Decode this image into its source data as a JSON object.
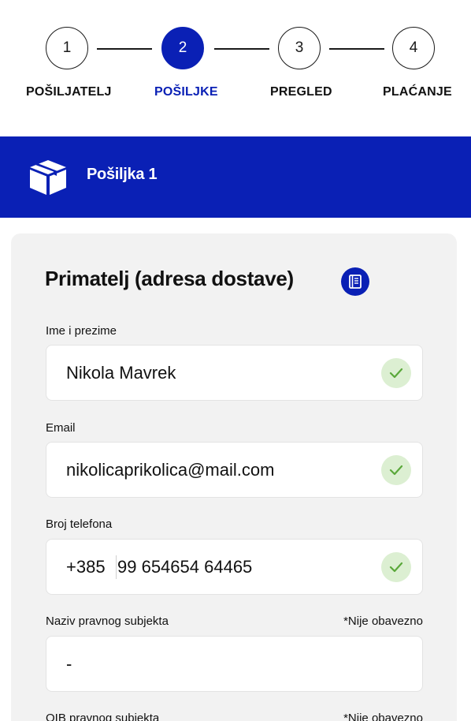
{
  "stepper": {
    "steps": [
      {
        "number": "1",
        "label": "POŠILJATELJ",
        "active": false
      },
      {
        "number": "2",
        "label": "POŠILJKE",
        "active": true
      },
      {
        "number": "3",
        "label": "PREGLED",
        "active": false
      },
      {
        "number": "4",
        "label": "PLAĆANJE",
        "active": false
      }
    ]
  },
  "banner": {
    "title": "Pošiljka 1",
    "icon": "package-box-icon"
  },
  "form": {
    "title": "Primatelj (adresa dostave)",
    "address_book_icon": "address-book-icon",
    "fields": [
      {
        "label": "Ime i prezime",
        "value": "Nikola Mavrek",
        "valid": true
      },
      {
        "label": "Email",
        "value": "nikolicaprikolica@mail.com",
        "valid": true
      },
      {
        "label": "Broj telefona",
        "prefix": "+385",
        "value": "99 654654 64465",
        "valid": true
      },
      {
        "label": "Naziv pravnog subjekta",
        "optional": "*Nije obavezno",
        "value": "-"
      },
      {
        "label": "OIB pravnog subjekta",
        "optional": "*Nije obavezno",
        "value": ""
      }
    ]
  },
  "colors": {
    "primary": "#0a20b5",
    "card_bg": "#f2f2f2",
    "valid_bg": "#dcefd2",
    "valid_check": "#5aa83a"
  }
}
